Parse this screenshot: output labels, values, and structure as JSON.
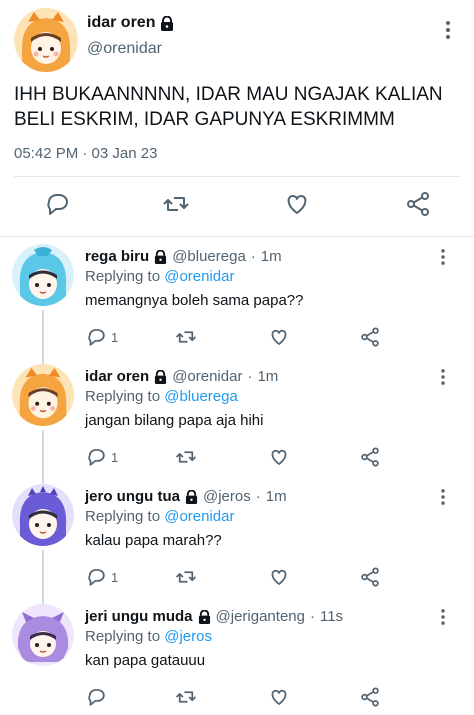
{
  "main_tweet": {
    "name": "idar oren",
    "handle": "@orenidar",
    "text": "IHH BUKAANNNNN, IDAR MAU NGAJAK KALIAN BELI ESKRIM, IDAR GAPUNYA ESKRIMMM",
    "time": "05:42 PM · 03 Jan 23",
    "avatar_color": "#f5a540"
  },
  "replies": [
    {
      "name": "rega biru",
      "handle": "@bluerega",
      "time": "1m",
      "replying_prefix": "Replying to",
      "replying_to": "@orenidar",
      "text": "memangnya boleh sama papa??",
      "reply_count": "1",
      "avatar_color": "#5bc8e8"
    },
    {
      "name": "idar oren",
      "handle": "@orenidar",
      "time": "1m",
      "replying_prefix": "Replying to",
      "replying_to": "@bluerega",
      "text": "jangan bilang papa aja hihi",
      "reply_count": "1",
      "avatar_color": "#f5a540"
    },
    {
      "name": "jero ungu tua",
      "handle": "@jeros",
      "time": "1m",
      "replying_prefix": "Replying to",
      "replying_to": "@orenidar",
      "text": "kalau papa marah??",
      "reply_count": "1",
      "avatar_color": "#6a5bd6"
    },
    {
      "name": "jeri ungu muda",
      "handle": "@jeriganteng",
      "time": "11s",
      "replying_prefix": "Replying to",
      "replying_to": "@jeros",
      "text": "kan papa gatauuu",
      "reply_count": "",
      "avatar_color": "#a98be0"
    }
  ],
  "icons": {
    "lock": "lock-icon",
    "more": "more-vertical-icon",
    "reply": "reply-icon",
    "retweet": "retweet-icon",
    "like": "heart-icon",
    "share": "share-icon"
  },
  "colors": {
    "accent": "#1d9bf0",
    "muted": "#536471",
    "text": "#0f1419",
    "divider": "#e1e8ed"
  }
}
